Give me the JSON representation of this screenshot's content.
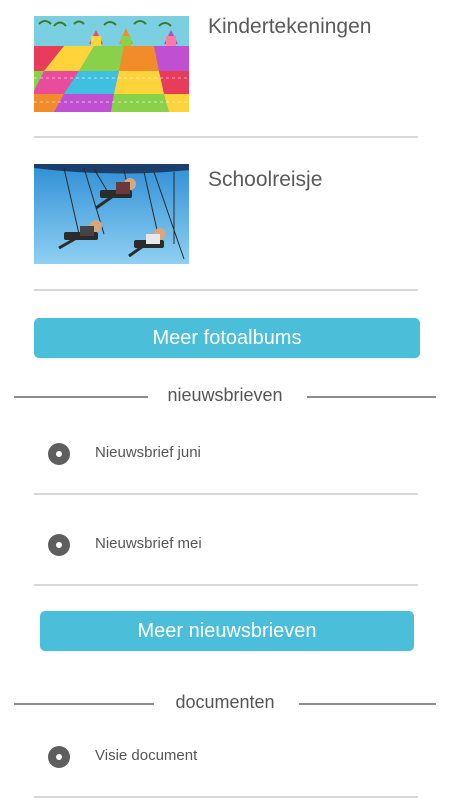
{
  "photo_albums": {
    "items": [
      {
        "title": "Kindertekeningen",
        "thumbnail": "children-drawing-thumbnail"
      },
      {
        "title": "Schoolreisje",
        "thumbnail": "swing-carousel-photo-thumbnail"
      }
    ],
    "more_button_label": "Meer fotoalbums"
  },
  "newsletters": {
    "header": "nieuwsbrieven",
    "items": [
      {
        "label": "Nieuwsbrief juni",
        "icon": "bullet-circle-icon"
      },
      {
        "label": "Nieuwsbrief mei",
        "icon": "bullet-circle-icon"
      }
    ],
    "more_button_label": "Meer nieuwsbrieven"
  },
  "documents": {
    "header": "documenten",
    "items": [
      {
        "label": "Visie document",
        "icon": "bullet-circle-icon"
      }
    ]
  },
  "colors": {
    "button": "#4bbfda",
    "button_text": "#ffffff",
    "text": "#555555",
    "divider": "#d8d8d8",
    "section_line": "#8c8c8c"
  }
}
